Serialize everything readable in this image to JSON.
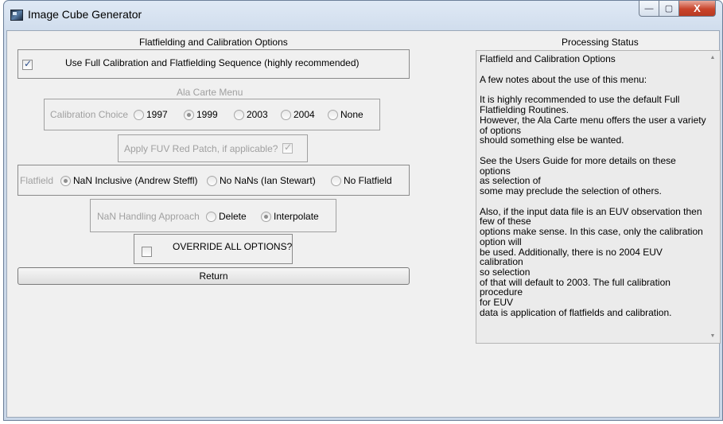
{
  "window": {
    "title": "Image Cube Generator",
    "controls": {
      "minimize": "—",
      "maximize": "▢",
      "close": "X"
    }
  },
  "left": {
    "section_title": "Flatfielding and Calibration Options",
    "full_sequence": {
      "label": "Use Full Calibration and Flatfielding Sequence (highly recommended)",
      "checked": true
    },
    "alacarte_title": "Ala Carte Menu",
    "calibration": {
      "label": "Calibration Choice",
      "options": [
        "1997",
        "1999",
        "2003",
        "2004",
        "None"
      ],
      "selected": "1999"
    },
    "fuv_patch": {
      "label": "Apply FUV Red Patch, if applicable?",
      "checked": true
    },
    "flatfield": {
      "label": "Flatfield",
      "options": [
        "NaN Inclusive (Andrew Steffl)",
        "No NaNs (Ian Stewart)",
        "No Flatfield"
      ],
      "selected": "NaN Inclusive (Andrew Steffl)"
    },
    "nan_handling": {
      "label": "NaN Handling Approach",
      "options": [
        "Delete",
        "Interpolate"
      ],
      "selected": "Interpolate"
    },
    "override": {
      "label": "OVERRIDE ALL OPTIONS?",
      "checked": false
    },
    "return_label": "Return"
  },
  "right": {
    "section_title": "Processing Status",
    "lines": [
      "Flatfield and Calibration Options",
      "",
      "A few notes about the use of this menu:",
      "",
      "It is highly recommended to use the default Full",
      "Flatfielding Routines.",
      "However, the Ala Carte menu offers the user a variety",
      "of options",
      "should something else be wanted.",
      "",
      "See the Users Guide for more details on these options",
      "as selection of",
      "some may preclude the selection of others.",
      "",
      "Also, if the input data file is an EUV observation then",
      "few of these",
      "options make sense. In this case, only the calibration",
      "option will",
      "be used. Additionally, there is no 2004 EUV calibration",
      "so selection",
      "of that will default to 2003. The full calibration procedure",
      "for EUV",
      "data is application of flatfields and calibration."
    ]
  }
}
